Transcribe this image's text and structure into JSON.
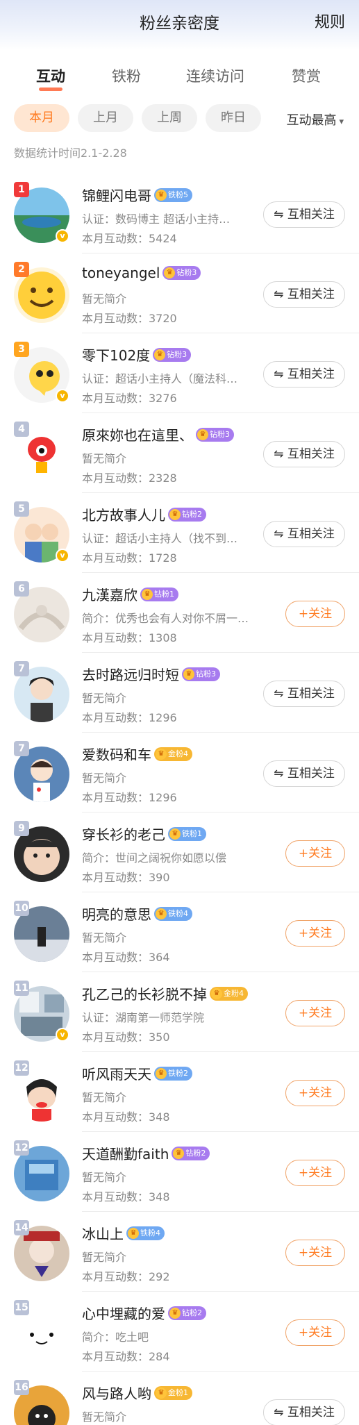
{
  "header": {
    "title": "粉丝亲密度",
    "rules": "规则"
  },
  "tabs": [
    "互动",
    "铁粉",
    "连续访问",
    "赞赏"
  ],
  "filters": [
    "本月",
    "上月",
    "上周",
    "昨日"
  ],
  "sort": {
    "label": "互动最高",
    "caret": "▾"
  },
  "stat_time": "数据统计时间2.1-2.28",
  "fans": [
    {
      "rank": "1",
      "name": "锦鲤闪电哥",
      "badge": "铁粉5",
      "desc": "认证：数码博主 超话小主持…",
      "count": "本月互动数：5424",
      "button": "⇋ 互相关注",
      "verified": true
    },
    {
      "rank": "2",
      "name": "toneyangel",
      "badge": "钻粉3",
      "desc": "暂无简介",
      "count": "本月互动数：3720",
      "button": "⇋ 互相关注",
      "verified": false
    },
    {
      "rank": "3",
      "name": "零下102度",
      "badge": "钻粉3",
      "desc": "认证：超话小主持人（魔法科…",
      "count": "本月互动数：3276",
      "button": "⇋ 互相关注",
      "verified": true
    },
    {
      "rank": "4",
      "name": "原來妳也在這里、",
      "badge": "钻粉3",
      "desc": "暂无简介",
      "count": "本月互动数：2328",
      "button": "⇋ 互相关注",
      "verified": false
    },
    {
      "rank": "5",
      "name": "北方故事人儿",
      "badge": "钻粉2",
      "desc": "认证：超话小主持人（找不到…",
      "count": "本月互动数：1728",
      "button": "⇋ 互相关注",
      "verified": true
    },
    {
      "rank": "6",
      "name": "九漢嘉欣",
      "badge": "钻粉1",
      "desc": "简介：优秀也会有人对你不屑一…",
      "count": "本月互动数：1308",
      "button": "+关注",
      "verified": false
    },
    {
      "rank": "7",
      "name": "去时路远归时短",
      "badge": "钻粉3",
      "desc": "暂无简介",
      "count": "本月互动数：1296",
      "button": "⇋ 互相关注",
      "verified": false
    },
    {
      "rank": "7",
      "name": "爱数码和车",
      "badge": "金粉4",
      "desc": "暂无简介",
      "count": "本月互动数：1296",
      "button": "⇋ 互相关注",
      "verified": false
    },
    {
      "rank": "9",
      "name": "穿长衫的老己",
      "badge": "铁粉1",
      "desc": "简介：世间之阔祝你如愿以偿",
      "count": "本月互动数：390",
      "button": "+关注",
      "verified": false
    },
    {
      "rank": "10",
      "name": "明亮的意思",
      "badge": "铁粉4",
      "desc": "暂无简介",
      "count": "本月互动数：364",
      "button": "+关注",
      "verified": false
    },
    {
      "rank": "11",
      "name": "孔乙己的长衫脱不掉",
      "badge": "金粉4",
      "desc": "认证：湖南第一师范学院",
      "count": "本月互动数：350",
      "button": "+关注",
      "verified": true
    },
    {
      "rank": "12",
      "name": "听风雨天天",
      "badge": "铁粉2",
      "desc": "暂无简介",
      "count": "本月互动数：348",
      "button": "+关注",
      "verified": false
    },
    {
      "rank": "12",
      "name": "天道酬勤faith",
      "badge": "钻粉2",
      "desc": "暂无简介",
      "count": "本月互动数：348",
      "button": "+关注",
      "verified": false
    },
    {
      "rank": "14",
      "name": "冰山上",
      "badge": "铁粉4",
      "desc": "暂无简介",
      "count": "本月互动数：292",
      "button": "+关注",
      "verified": false
    },
    {
      "rank": "15",
      "name": "心中埋藏的爱",
      "badge": "钻粉2",
      "desc": "简介：吃土吧",
      "count": "本月互动数：284",
      "button": "+关注",
      "verified": false
    },
    {
      "rank": "16",
      "name": "风与路人哟",
      "badge": "金粉1",
      "desc": "暂无简介",
      "count": "",
      "button": "⇋ 互相关注",
      "verified": false
    }
  ],
  "colors": {
    "accent": "#ff7a1f",
    "rank1": "#f03a3a",
    "rank2": "#ff7a2a",
    "rank3": "#ffa51f",
    "rank_other": "#b9c1d6",
    "badge_tie": "#6fa8f2",
    "badge_zuan": "#a77bef",
    "badge_jin": "#f7b733"
  }
}
